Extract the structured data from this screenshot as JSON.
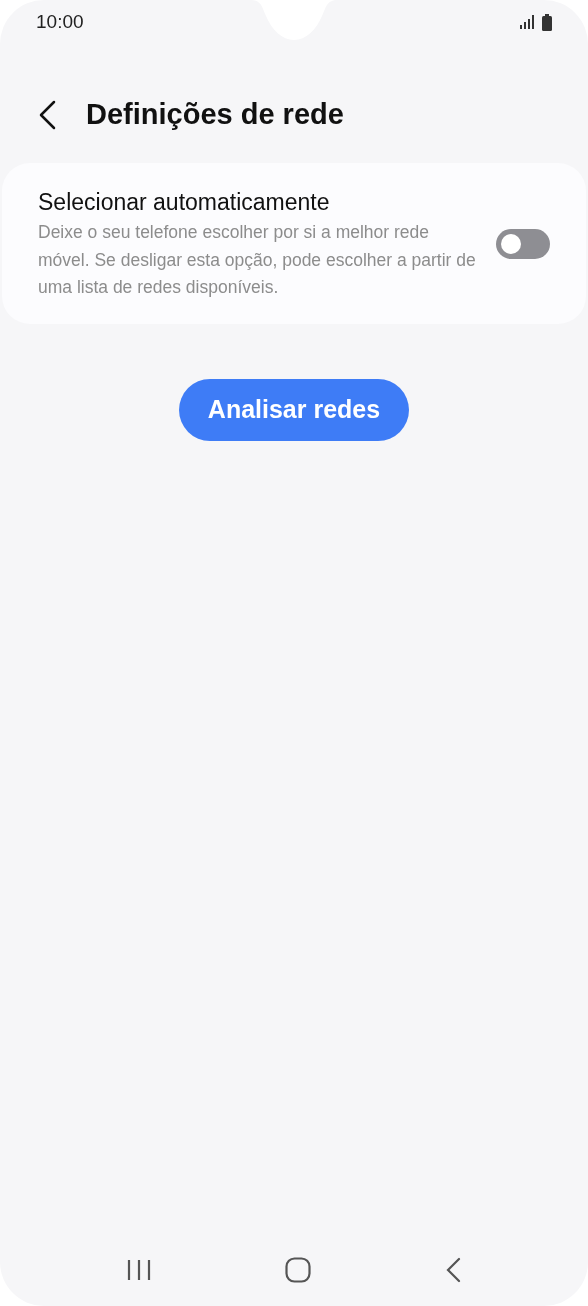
{
  "status_bar": {
    "time": "10:00"
  },
  "header": {
    "title": "Definições de rede"
  },
  "setting": {
    "title": "Selecionar automaticamente",
    "description": "Deixe o seu telefone escolher por si a melhor rede móvel. Se desligar esta opção, pode escolher a partir de uma lista de redes disponíveis.",
    "on": false
  },
  "button": {
    "label": "Analisar redes"
  }
}
